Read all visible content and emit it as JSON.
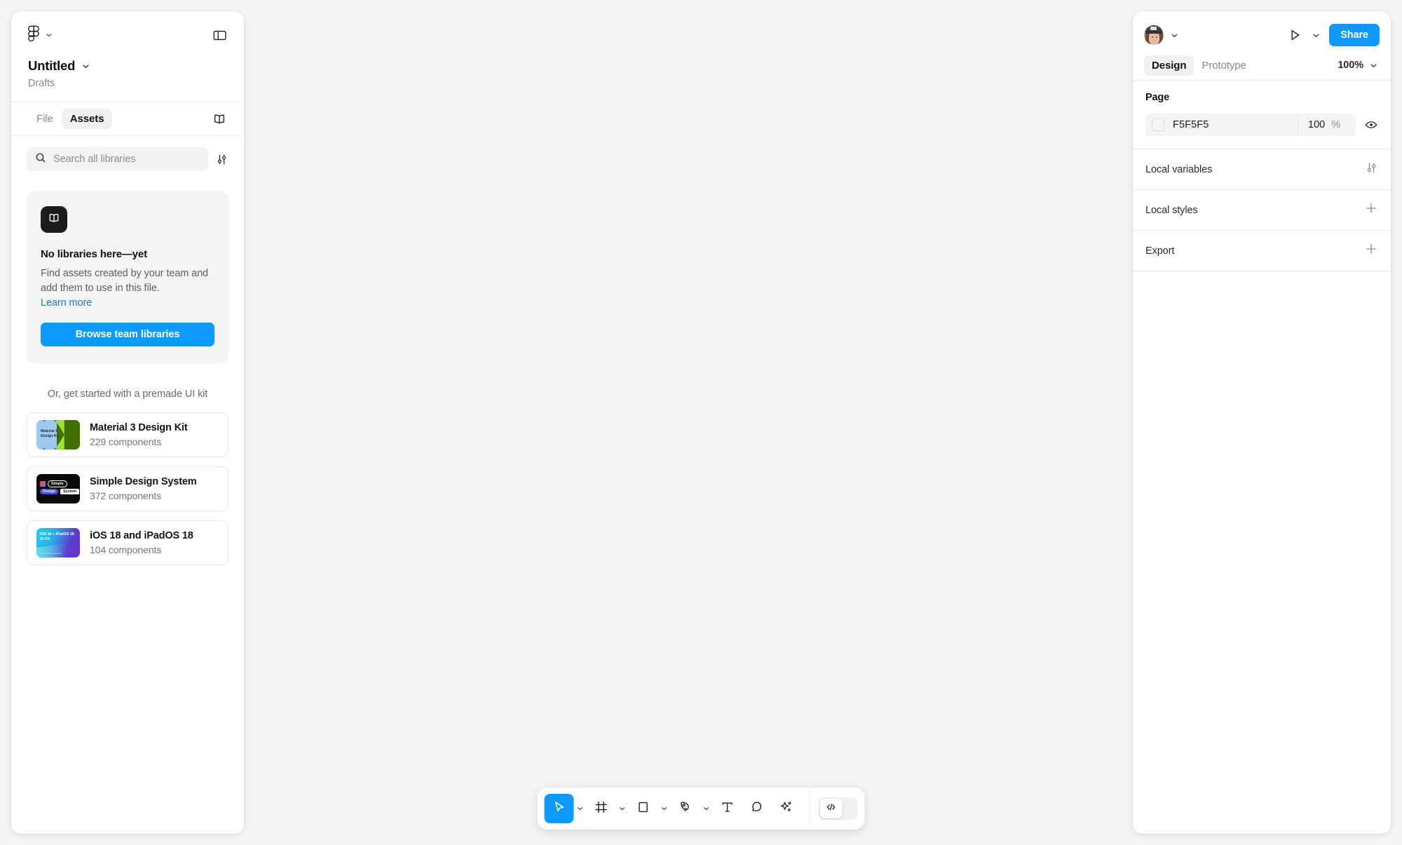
{
  "app": {
    "name": "Figma",
    "canvas_background": "#F5F5F5",
    "accent_color": "#0D99FF"
  },
  "left_panel": {
    "logo_icon": "figma-logo-icon",
    "main_menu_chevron": "chevron-down-icon",
    "layout_toggle_icon": "panel-layout-icon",
    "file_title": "Untitled",
    "file_title_chevron": "chevron-down-icon",
    "file_location": "Drafts",
    "tabs": [
      {
        "label": "File",
        "active": false
      },
      {
        "label": "Assets",
        "active": true
      }
    ],
    "libraries_icon": "open-book-icon",
    "search": {
      "icon": "search-icon",
      "placeholder": "Search all libraries",
      "value": "",
      "filter_icon": "sliders-filter-icon"
    },
    "empty_state": {
      "badge_icon": "open-book-icon",
      "title": "No libraries here—yet",
      "body": "Find assets created by your team and add them to use in this file.",
      "link": "Learn more",
      "button": "Browse team libraries",
      "button_color": "#0D99FF",
      "link_color": "#1878F0"
    },
    "kits_heading": "Or, get started with a premade UI kit",
    "kits": [
      {
        "name": "Material 3 Design Kit",
        "count": "229 components",
        "thumb": "material3-thumbnail",
        "thumb_text_line1": "Material 3",
        "thumb_text_line2": "Design Kit",
        "thumb_colors": [
          "#9EC8F0",
          "#3F7000",
          "#9FE03A"
        ]
      },
      {
        "name": "Simple Design System",
        "count": "372 components",
        "thumb": "simple-design-system-thumbnail",
        "thumb_chips": [
          "Simple",
          "Design",
          "System"
        ],
        "thumb_colors": [
          "#0A0A0A",
          "#4B4BE8",
          "#FFFFFF"
        ]
      },
      {
        "name": "iOS 18 and iPadOS 18",
        "count": "104 components",
        "thumb": "ios18-thumbnail",
        "thumb_text_line1": "iOS 18 + iPadOS 18",
        "thumb_text_line2": "UI Kit",
        "thumb_text_line3": "if you're into prototypes",
        "thumb_colors": [
          "#18D4E8",
          "#6A2FC4"
        ]
      }
    ]
  },
  "right_panel": {
    "avatar": "user-avatar",
    "avatar_chevron": "chevron-down-icon",
    "present_icon": "play-present-icon",
    "present_chevron": "chevron-down-icon",
    "share_button": "Share",
    "share_button_color": "#0D99FF",
    "tabs": [
      {
        "label": "Design",
        "active": true
      },
      {
        "label": "Prototype",
        "active": false
      }
    ],
    "zoom_value": "100%",
    "zoom_chevron": "chevron-down-icon",
    "page_section": {
      "label": "Page",
      "swatch_color": "#F5F5F5",
      "hex": "F5F5F5",
      "opacity": "100",
      "opacity_unit": "%",
      "visibility_icon": "eye-icon"
    },
    "sections": [
      {
        "label": "Local variables",
        "action_icon": "sliders-filter-icon"
      },
      {
        "label": "Local styles",
        "action_icon": "plus-icon"
      },
      {
        "label": "Export",
        "action_icon": "plus-icon"
      }
    ]
  },
  "toolbar": {
    "tools": [
      {
        "name": "move-tool",
        "icon": "cursor-arrow-icon",
        "active": true,
        "has_chevron": true
      },
      {
        "name": "frame-tool",
        "icon": "frame-hash-icon",
        "active": false,
        "has_chevron": true
      },
      {
        "name": "shape-tool",
        "icon": "square-shape-icon",
        "active": false,
        "has_chevron": true
      },
      {
        "name": "pen-tool",
        "icon": "pen-nib-icon",
        "active": false,
        "has_chevron": true
      },
      {
        "name": "text-tool",
        "icon": "text-t-icon",
        "active": false,
        "has_chevron": false
      },
      {
        "name": "comment-tool",
        "icon": "comment-bubble-icon",
        "active": false,
        "has_chevron": false
      },
      {
        "name": "actions-tool",
        "icon": "sparkle-plus-icon",
        "active": false,
        "has_chevron": false
      }
    ],
    "code_toggle": {
      "icon": "code-brackets-icon",
      "on": false
    }
  }
}
